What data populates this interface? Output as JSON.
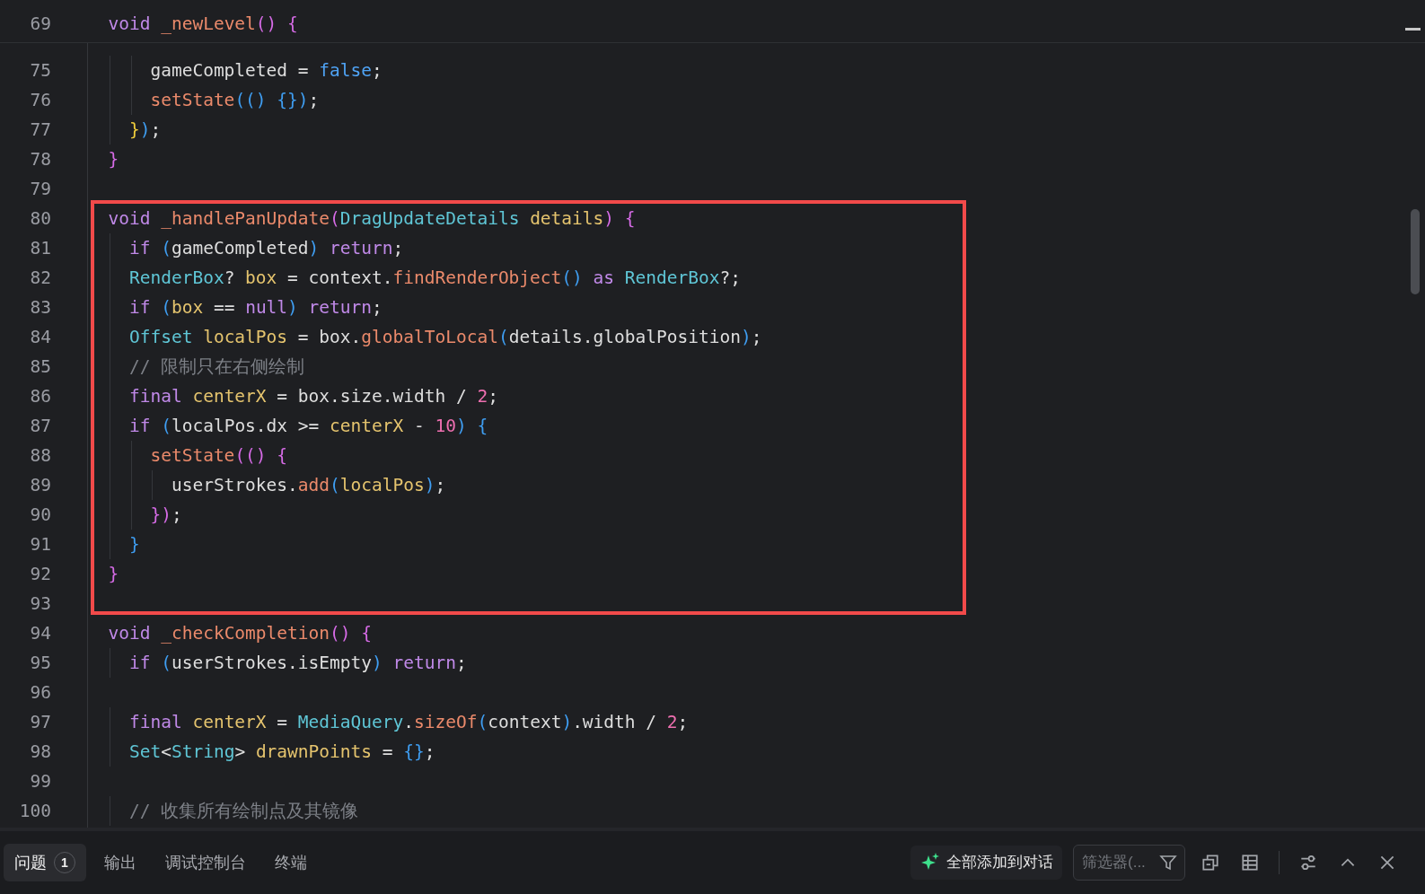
{
  "sticky_line": {
    "number": "69",
    "tokens": [
      {
        "kind": "kw",
        "text": "  void"
      },
      {
        "kind": "fn",
        "text": " _newLevel"
      },
      {
        "kind": "b2",
        "text": "()"
      },
      {
        "kind": "b2",
        "text": " {"
      }
    ]
  },
  "blocks": [
    {
      "highlighted": false,
      "lines": [
        {
          "number": "75",
          "tokens": [
            {
              "kind": "plain",
              "text": "      gameCompleted = "
            },
            {
              "kind": "lit",
              "text": "false"
            },
            {
              "kind": "plain",
              "text": ";"
            }
          ]
        },
        {
          "number": "76",
          "tokens": [
            {
              "kind": "fn",
              "text": "      setState"
            },
            {
              "kind": "b3",
              "text": "(() {})"
            },
            {
              "kind": "plain",
              "text": ";"
            }
          ]
        },
        {
          "number": "77",
          "tokens": [
            {
              "kind": "b1",
              "text": "    }"
            },
            {
              "kind": "b3",
              "text": ")"
            },
            {
              "kind": "plain",
              "text": ";"
            }
          ]
        },
        {
          "number": "78",
          "tokens": [
            {
              "kind": "b2",
              "text": "  }"
            }
          ]
        },
        {
          "number": "79"
        }
      ]
    },
    {
      "highlighted": true,
      "lines": [
        {
          "number": "80",
          "tokens": [
            {
              "kind": "kw",
              "text": "  void"
            },
            {
              "kind": "fn",
              "text": " _handlePanUpdate"
            },
            {
              "kind": "b2",
              "text": "("
            },
            {
              "kind": "type",
              "text": "DragUpdateDetails"
            },
            {
              "kind": "var",
              "text": " details"
            },
            {
              "kind": "b2",
              "text": ")"
            },
            {
              "kind": "b2",
              "text": " {"
            }
          ]
        },
        {
          "number": "81",
          "tokens": [
            {
              "kind": "kw",
              "text": "    if"
            },
            {
              "kind": "b3",
              "text": " ("
            },
            {
              "kind": "plain",
              "text": "gameCompleted"
            },
            {
              "kind": "b3",
              "text": ")"
            },
            {
              "kind": "kw",
              "text": " return"
            },
            {
              "kind": "plain",
              "text": ";"
            }
          ]
        },
        {
          "number": "82",
          "tokens": [
            {
              "kind": "type",
              "text": "    RenderBox"
            },
            {
              "kind": "plain",
              "text": "? "
            },
            {
              "kind": "var",
              "text": "box"
            },
            {
              "kind": "plain",
              "text": " = context."
            },
            {
              "kind": "fn",
              "text": "findRenderObject"
            },
            {
              "kind": "b3",
              "text": "()"
            },
            {
              "kind": "kw",
              "text": " as"
            },
            {
              "kind": "type",
              "text": " RenderBox"
            },
            {
              "kind": "plain",
              "text": "?;"
            }
          ]
        },
        {
          "number": "83",
          "tokens": [
            {
              "kind": "kw",
              "text": "    if"
            },
            {
              "kind": "b3",
              "text": " ("
            },
            {
              "kind": "var",
              "text": "box"
            },
            {
              "kind": "plain",
              "text": " == "
            },
            {
              "kind": "kw",
              "text": "null"
            },
            {
              "kind": "b3",
              "text": ")"
            },
            {
              "kind": "kw",
              "text": " return"
            },
            {
              "kind": "plain",
              "text": ";"
            }
          ]
        },
        {
          "number": "84",
          "tokens": [
            {
              "kind": "type",
              "text": "    Offset"
            },
            {
              "kind": "var",
              "text": " localPos"
            },
            {
              "kind": "plain",
              "text": " = box."
            },
            {
              "kind": "fn",
              "text": "globalToLocal"
            },
            {
              "kind": "b3",
              "text": "("
            },
            {
              "kind": "plain",
              "text": "details.globalPosition"
            },
            {
              "kind": "b3",
              "text": ")"
            },
            {
              "kind": "plain",
              "text": ";"
            }
          ]
        },
        {
          "number": "85",
          "tokens": [
            {
              "kind": "comment",
              "text": "    // 限制只在右侧绘制"
            }
          ]
        },
        {
          "number": "86",
          "tokens": [
            {
              "kind": "kw",
              "text": "    final"
            },
            {
              "kind": "var",
              "text": " centerX"
            },
            {
              "kind": "plain",
              "text": " = box.size.width / "
            },
            {
              "kind": "num",
              "text": "2"
            },
            {
              "kind": "plain",
              "text": ";"
            }
          ]
        },
        {
          "number": "87",
          "tokens": [
            {
              "kind": "kw",
              "text": "    if"
            },
            {
              "kind": "b3",
              "text": " ("
            },
            {
              "kind": "plain",
              "text": "localPos.dx >= "
            },
            {
              "kind": "var",
              "text": "centerX"
            },
            {
              "kind": "plain",
              "text": " - "
            },
            {
              "kind": "num",
              "text": "10"
            },
            {
              "kind": "b3",
              "text": ")"
            },
            {
              "kind": "b3",
              "text": " {"
            }
          ]
        },
        {
          "number": "88",
          "tokens": [
            {
              "kind": "fn",
              "text": "      setState"
            },
            {
              "kind": "b2",
              "text": "(() {"
            }
          ]
        },
        {
          "number": "89",
          "tokens": [
            {
              "kind": "plain",
              "text": "        userStrokes."
            },
            {
              "kind": "fn",
              "text": "add"
            },
            {
              "kind": "b3",
              "text": "("
            },
            {
              "kind": "var",
              "text": "localPos"
            },
            {
              "kind": "b3",
              "text": ")"
            },
            {
              "kind": "plain",
              "text": ";"
            }
          ]
        },
        {
          "number": "90",
          "tokens": [
            {
              "kind": "b2",
              "text": "      })"
            },
            {
              "kind": "plain",
              "text": ";"
            }
          ]
        },
        {
          "number": "91",
          "tokens": [
            {
              "kind": "b3",
              "text": "    }"
            }
          ]
        },
        {
          "number": "92",
          "tokens": [
            {
              "kind": "b2",
              "text": "  }"
            }
          ]
        },
        {
          "number": "93"
        }
      ]
    },
    {
      "highlighted": false,
      "lines": [
        {
          "number": "94",
          "tokens": [
            {
              "kind": "kw",
              "text": "  void"
            },
            {
              "kind": "fn",
              "text": " _checkCompletion"
            },
            {
              "kind": "b2",
              "text": "()"
            },
            {
              "kind": "b2",
              "text": " {"
            }
          ]
        },
        {
          "number": "95",
          "tokens": [
            {
              "kind": "kw",
              "text": "    if"
            },
            {
              "kind": "b3",
              "text": " ("
            },
            {
              "kind": "plain",
              "text": "userStrokes.isEmpty"
            },
            {
              "kind": "b3",
              "text": ")"
            },
            {
              "kind": "kw",
              "text": " return"
            },
            {
              "kind": "plain",
              "text": ";"
            }
          ]
        },
        {
          "number": "96"
        },
        {
          "number": "97",
          "tokens": [
            {
              "kind": "kw",
              "text": "    final"
            },
            {
              "kind": "var",
              "text": " centerX"
            },
            {
              "kind": "plain",
              "text": " = "
            },
            {
              "kind": "type",
              "text": "MediaQuery"
            },
            {
              "kind": "plain",
              "text": "."
            },
            {
              "kind": "fn",
              "text": "sizeOf"
            },
            {
              "kind": "b3",
              "text": "("
            },
            {
              "kind": "plain",
              "text": "context"
            },
            {
              "kind": "b3",
              "text": ")"
            },
            {
              "kind": "plain",
              "text": ".width / "
            },
            {
              "kind": "num",
              "text": "2"
            },
            {
              "kind": "plain",
              "text": ";"
            }
          ]
        },
        {
          "number": "98",
          "tokens": [
            {
              "kind": "type",
              "text": "    Set"
            },
            {
              "kind": "plain",
              "text": "<"
            },
            {
              "kind": "type",
              "text": "String"
            },
            {
              "kind": "plain",
              "text": "> "
            },
            {
              "kind": "var",
              "text": "drawnPoints"
            },
            {
              "kind": "plain",
              "text": " = "
            },
            {
              "kind": "b3",
              "text": "{}"
            },
            {
              "kind": "plain",
              "text": ";"
            }
          ]
        },
        {
          "number": "99"
        },
        {
          "number": "100",
          "tokens": [
            {
              "kind": "comment",
              "text": "    // 收集所有绘制点及其镜像"
            }
          ]
        }
      ]
    }
  ],
  "panel": {
    "tabs": [
      {
        "label": "问题",
        "selected": true,
        "badge": "1"
      },
      {
        "label": "输出",
        "selected": false
      },
      {
        "label": "调试控制台",
        "selected": false
      },
      {
        "label": "终端",
        "selected": false
      }
    ],
    "add_all_button": "全部添加到对话",
    "filter": {
      "placeholder": "筛选器(..."
    }
  }
}
